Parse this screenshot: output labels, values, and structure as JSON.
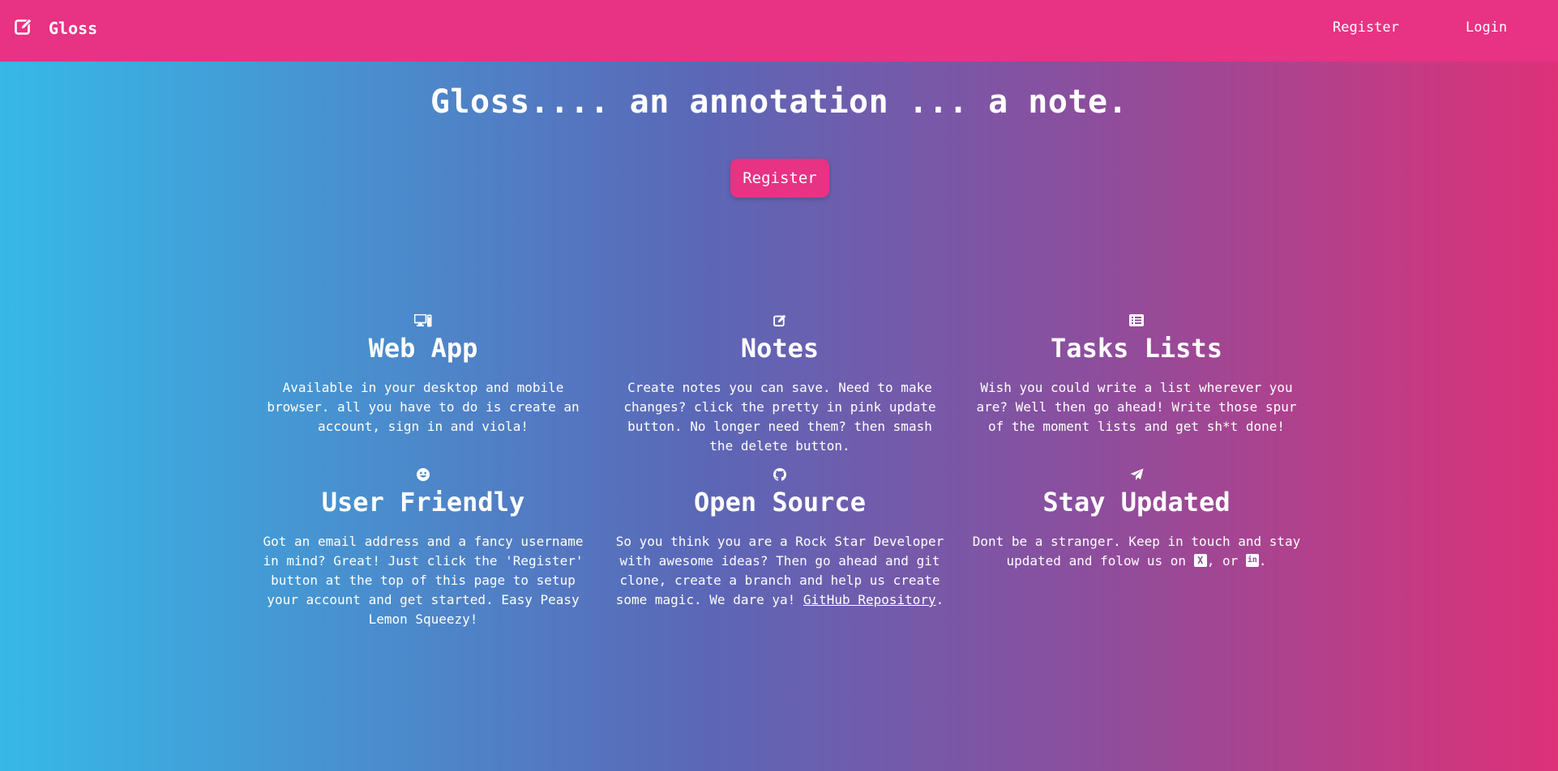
{
  "nav": {
    "brand": "Gloss",
    "brand_icon": "edit-icon",
    "links": [
      "Register",
      "Login"
    ]
  },
  "hero": {
    "title": "Gloss.... an annotation ... a note.",
    "button": "Register"
  },
  "features": [
    {
      "icon": "desktop-icon",
      "title": "Web App",
      "text": "Available in your desktop and mobile browser. all you have to do is create an account, sign in and viola!"
    },
    {
      "icon": "edit-icon",
      "title": "Notes",
      "text": "Create notes you can save. Need to make changes? click the pretty in pink update button. No longer need them? then smash the delete button."
    },
    {
      "icon": "list-icon",
      "title": "Tasks Lists",
      "text": "Wish you could write a list wherever you are? Well then go ahead! Write those spur of the moment lists and get sh*t done!"
    },
    {
      "icon": "smile-icon",
      "title": "User Friendly",
      "text": "Got an email address and a fancy username in mind? Great! Just click the 'Register' button at the top of this page to setup your account and get started. Easy Peasy Lemon Squeezy!"
    },
    {
      "icon": "github-icon",
      "title": "Open Source",
      "text_before": "So you think you are a Rock Star Developer with awesome ideas? Then go ahead and git clone, create a branch and help us create some magic. We dare ya! ",
      "link": "GitHub Repository",
      "text_after": "."
    },
    {
      "icon": "paper-plane-icon",
      "title": "Stay Updated",
      "text_before": "Dont be a stranger. Keep in touch and stay updated and folow us on ",
      "x_glyph": "X",
      "text_mid": ", or ",
      "in_glyph": "in",
      "text_after": "."
    }
  ],
  "colors": {
    "accent_pink": "#e83283",
    "gradient_start": "#36b9e7",
    "gradient_end": "#dd3178"
  }
}
